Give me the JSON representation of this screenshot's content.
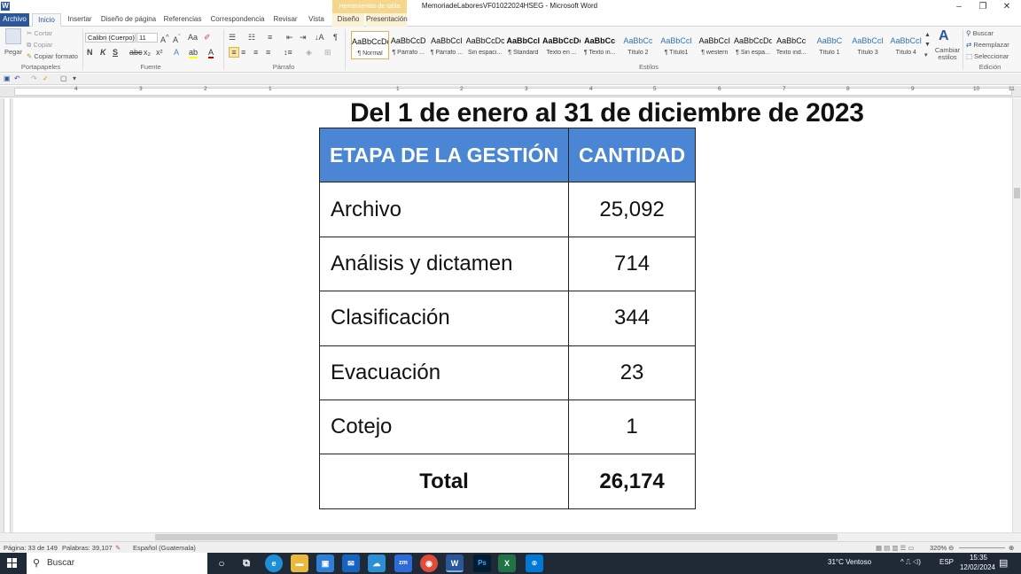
{
  "window": {
    "title": "MemoriadeLaboresVF01022024HSEG - Microsoft Word",
    "context_tab_header": "Herramientas de tabla",
    "minimize": "–",
    "maximize": "❐",
    "close": "✕"
  },
  "tabs": [
    "Archivo",
    "Inicio",
    "Insertar",
    "Diseño de página",
    "Referencias",
    "Correspondencia",
    "Revisar",
    "Vista",
    "Diseño",
    "Presentación"
  ],
  "active_tab": "Inicio",
  "clipboard": {
    "paste": "Pegar",
    "cut": "Cortar",
    "copy": "Copiar",
    "format_painter": "Copiar formato",
    "group_label": "Portapapeles"
  },
  "font": {
    "family": "Calibri (Cuerpo)",
    "size": "11",
    "bold": "N",
    "italic": "K",
    "underline": "S",
    "strike": "abc",
    "subscript": "x₂",
    "superscript": "x²",
    "group_label": "Fuente"
  },
  "paragraph": {
    "group_label": "Párrafo",
    "pilcrow": "¶"
  },
  "styles": {
    "group_label": "Estilos",
    "items": [
      {
        "preview": "AaBbCcDc",
        "name": "¶ Normal"
      },
      {
        "preview": "AaBbCcD",
        "name": "¶ Párrafo ..."
      },
      {
        "preview": "AaBbCcI",
        "name": "¶ Párrafo ..."
      },
      {
        "preview": "AaBbCcDc",
        "name": "Sin espaci..."
      },
      {
        "preview": "AaBbCcI",
        "name": "¶ Standard"
      },
      {
        "preview": "AaBbCcDc",
        "name": "Texto en ..."
      },
      {
        "preview": "AaBbCc",
        "name": "¶ Texto in..."
      },
      {
        "preview": "AaBbCc",
        "name": "Título 2"
      },
      {
        "preview": "AaBbCcI",
        "name": "¶ Título1"
      },
      {
        "preview": "AaBbCcI",
        "name": "¶ western"
      },
      {
        "preview": "AaBbCcDdI",
        "name": "¶ Sin espa..."
      },
      {
        "preview": "AaBbCc",
        "name": "Texto ind..."
      },
      {
        "preview": "AaBbC",
        "name": "Título 1"
      },
      {
        "preview": "AaBbCcI",
        "name": "Título 3"
      },
      {
        "preview": "AaBbCcI",
        "name": "Título 4"
      }
    ],
    "change_styles": "Cambiar estilos"
  },
  "editing": {
    "group_label": "Edición",
    "find": "Buscar",
    "replace": "Reemplazar",
    "select": "Seleccionar"
  },
  "ruler_numbers": [
    "4",
    "3",
    "2",
    "1",
    "1",
    "2",
    "3",
    "4",
    "5",
    "6",
    "7",
    "8",
    "9",
    "10",
    "11"
  ],
  "document": {
    "heading": "Del 1 de enero al 31 de diciembre de 2023",
    "table": {
      "headers": [
        "ETAPA DE LA GESTIÓN",
        "CANTIDAD"
      ],
      "rows": [
        [
          "Archivo",
          "25,092"
        ],
        [
          "Análisis y dictamen",
          "714"
        ],
        [
          "Clasificación",
          "344"
        ],
        [
          "Evacuación",
          "23"
        ],
        [
          "Cotejo",
          "1"
        ]
      ],
      "total": [
        "Total",
        "26,174"
      ]
    }
  },
  "status": {
    "page": "Página: 33 de 149",
    "words": "Palabras: 39,107",
    "language": "Español (Guatemala)",
    "zoom": "320%"
  },
  "taskbar": {
    "search": "Buscar",
    "weather": "31°C  Ventoso",
    "lang": "ESP",
    "time": "15:35",
    "date": "12/02/2024"
  }
}
